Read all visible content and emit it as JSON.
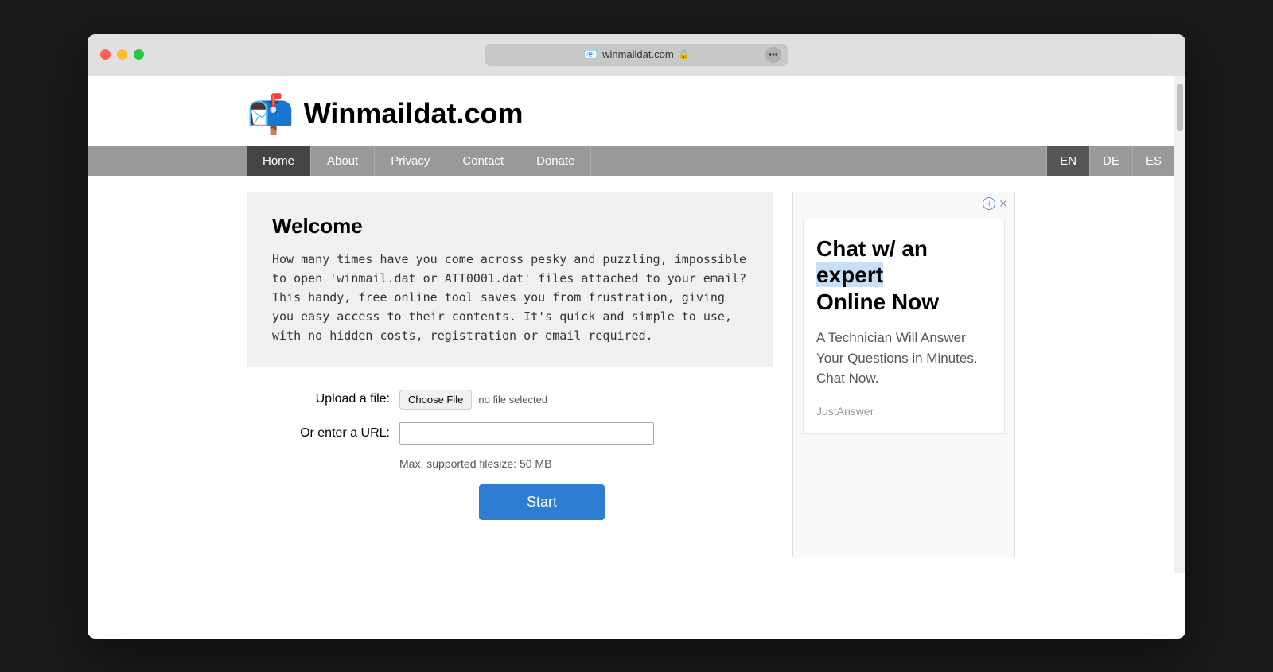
{
  "browser": {
    "address": "winmaildat.com",
    "favicon": "📧",
    "lock_symbol": "🔒",
    "dots": "•••"
  },
  "site": {
    "logo": "📬",
    "title": "Winmaildat.com"
  },
  "nav": {
    "items": [
      {
        "label": "Home",
        "active": true
      },
      {
        "label": "About",
        "active": false
      },
      {
        "label": "Privacy",
        "active": false
      },
      {
        "label": "Contact",
        "active": false
      },
      {
        "label": "Donate",
        "active": false
      }
    ],
    "languages": [
      {
        "label": "EN",
        "active": true
      },
      {
        "label": "DE",
        "active": false
      },
      {
        "label": "ES",
        "active": false
      }
    ]
  },
  "welcome": {
    "title": "Welcome",
    "text": "How many times have you come across pesky and puzzling, impossible to open 'winmail.dat or ATT0001.dat' files attached to your email? This handy, free online tool saves you from frustration, giving you easy access to their contents. It's quick and simple to use, with no hidden costs, registration or email required."
  },
  "form": {
    "upload_label": "Upload a file:",
    "choose_file_btn": "Choose File",
    "no_file_text": "no file selected",
    "url_label": "Or enter a URL:",
    "url_placeholder": "",
    "max_size": "Max. supported filesize: 50 MB",
    "start_btn": "Start"
  },
  "ad": {
    "headline_part1": "Chat w/ an",
    "headline_part2": "expert",
    "headline_part3": "Online Now",
    "body": "A Technician Will Answer Your Questions in Minutes. Chat Now.",
    "source": "JustAnswer"
  }
}
